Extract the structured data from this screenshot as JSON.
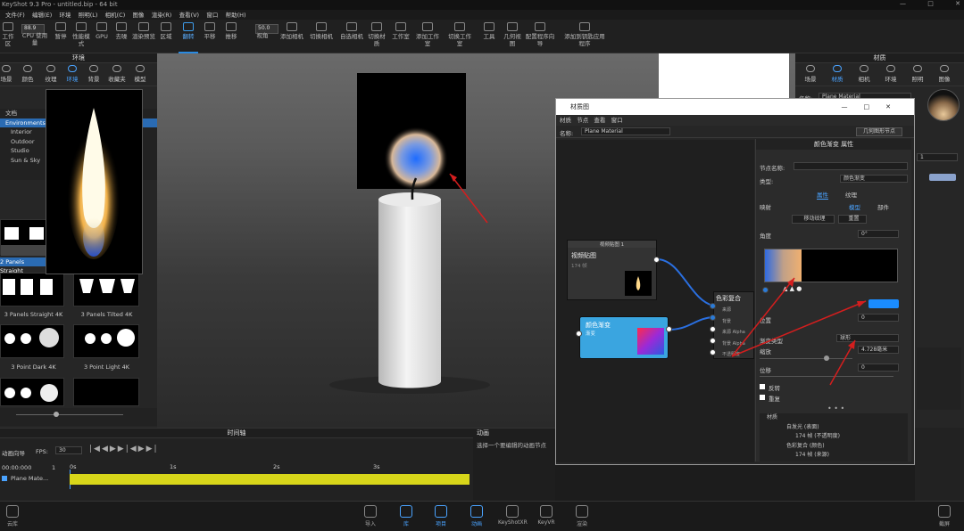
{
  "window": {
    "title": "KeyShot 9.3 Pro  -  untitled.bip  -  64 bit",
    "controls": [
      "—",
      "□",
      "✕"
    ]
  },
  "menu": [
    "文件(F)",
    "编辑(E)",
    "环境",
    "照明(L)",
    "相机(C)",
    "图像",
    "渲染(R)",
    "查看(V)",
    "窗口",
    "帮助(H)"
  ],
  "ribbon": {
    "zoom_value": "88.9",
    "cpu_label": "CPU 使用量",
    "fov_value": "50.0",
    "buttons": [
      "工作区",
      "CPU 使用量",
      "暂停",
      "性能模式",
      "GPU",
      "去噪",
      "渲染预览",
      "区域",
      "翻转",
      "平移",
      "推移",
      "视角",
      "添加相机",
      "切换相机",
      "自选相机",
      "切换材质",
      "工作室",
      "添加工作室",
      "切换工作室",
      "工具",
      "几何视图",
      "配置程序向导",
      "添加到钥匙应用程序"
    ],
    "active": "翻转"
  },
  "left_panel": {
    "header": "环境",
    "tabs": [
      "场景",
      "颜色",
      "纹理",
      "环境",
      "背景",
      "收藏夹",
      "模型"
    ],
    "active_tab": "环境",
    "tree": [
      "文档",
      "Environments",
      "Interior",
      "Outdoor",
      "Studio",
      "Sun & Sky"
    ],
    "selected": "Environments",
    "thumbs": [
      "2 Panels Straight",
      "3 Panels Straight 4K",
      "3 Panels Tilted 4K",
      "3 Point Dark 4K",
      "3 Point Light 4K"
    ]
  },
  "right_panel": {
    "header": "材质",
    "tabs": [
      "场景",
      "材质",
      "相机",
      "环境",
      "照明",
      "图像"
    ],
    "name_label": "名称:",
    "name_value": "Plane Material",
    "field_value": "1"
  },
  "material_graph": {
    "title": "材质图",
    "menu": [
      "材质",
      "节点",
      "查看",
      "窗口"
    ],
    "name_label": "名称:",
    "name_value": "Plane Material",
    "toolbar_button": "几何图形节点",
    "nodes": {
      "video": {
        "title": "视频贴图 1",
        "label": "视频贴图",
        "sub": "174 帧"
      },
      "gradient": {
        "title": "颜色渐变",
        "sub": "渐变"
      },
      "composite": {
        "title": "色彩复合",
        "ports": [
          "来源",
          "背景",
          "来源 Alpha",
          "背景 Alpha",
          "不透明度"
        ]
      }
    },
    "properties": {
      "header": "颜色渐变 属性",
      "node_name_label": "节点名称:",
      "type_label": "类型:",
      "type_value": "颜色渐变",
      "tabs": [
        "属性",
        "纹理"
      ],
      "mapping_label": "映射",
      "mapping_options": [
        "模型",
        "部件"
      ],
      "move_texture": "移动纹理",
      "reset": "重置",
      "angle_label": "角度",
      "angle_value": "0°",
      "position_label": "位置",
      "position_value": "0",
      "gradient_type_label": "渐变类型",
      "gradient_type_value": "球形",
      "scale_label": "缩放",
      "scale_value": "4.728毫米",
      "shift_label": "位移",
      "shift_value": "0",
      "checkbox_reverse": "反转",
      "checkbox_repeat": "重复",
      "tree": [
        "材质",
        "自发光 (表面)",
        "174 帧 (不透明度)",
        "色彩复合 (颜色)",
        "174 帧 (来源)"
      ],
      "gradient_stop_color": "#1a8cff"
    }
  },
  "timeline": {
    "header": "时间轴",
    "anim_label": "动画向导",
    "fps_label": "FPS:",
    "fps_value": "30",
    "time": "00:00:000",
    "ticks": [
      "0s",
      "1s",
      "2s",
      "3s"
    ],
    "track_label": "Plane Mate...",
    "track_color": "#d8d61a",
    "frame": "1"
  },
  "animation_panel": {
    "header": "动画",
    "text": "选择一个要编辑的动画节点"
  },
  "bottom_bar": {
    "left": "云库",
    "buttons": [
      "导入",
      "库",
      "项目",
      "动画",
      "KeyShotXR",
      "KeyVR",
      "渲染"
    ],
    "active": "动画",
    "right": "截屏"
  },
  "colors": {
    "accent": "#2a8ae0",
    "arrow": "#d41e1e",
    "gradient_node": "#3aa5e0"
  }
}
